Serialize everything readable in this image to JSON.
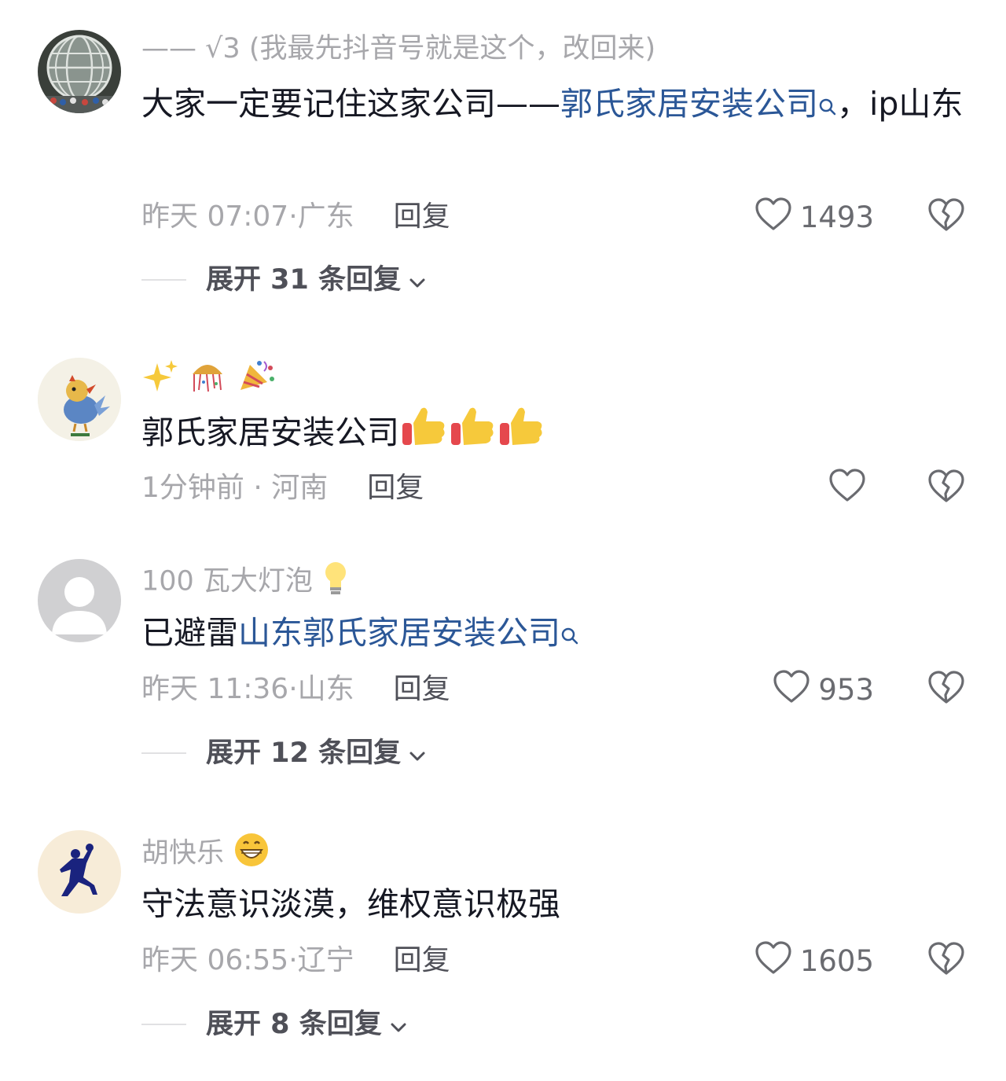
{
  "comments": [
    {
      "username": "—— √3 (我最先抖音号就是这个，改回来)",
      "text_before": "大家一定要记住这家公司——",
      "link": "郭氏家居安装公司",
      "text_after": "，ip山东",
      "time": "昨天 07:07",
      "location": "广东",
      "reply_label": "回复",
      "likes": "1493",
      "expand_label": "展开 31 条回复"
    },
    {
      "username": "",
      "text": "郭氏家居安装公司",
      "time": "1分钟前",
      "location": "河南",
      "reply_label": "回复",
      "likes": ""
    },
    {
      "username": "100 瓦大灯泡",
      "text_before": "已避雷",
      "link": "山东郭氏家居安装公司",
      "time": "昨天 11:36",
      "location": "山东",
      "reply_label": "回复",
      "likes": "953",
      "expand_label": "展开 12 条回复"
    },
    {
      "username": "胡快乐",
      "text": "守法意识淡漠，维权意识极强",
      "time": "昨天 06:55",
      "location": "辽宁",
      "reply_label": "回复",
      "likes": "1605",
      "expand_label": "展开 8 条回复"
    }
  ],
  "colors": {
    "link": "#2b5797",
    "meta": "#a7a7ab",
    "text": "#161823"
  }
}
